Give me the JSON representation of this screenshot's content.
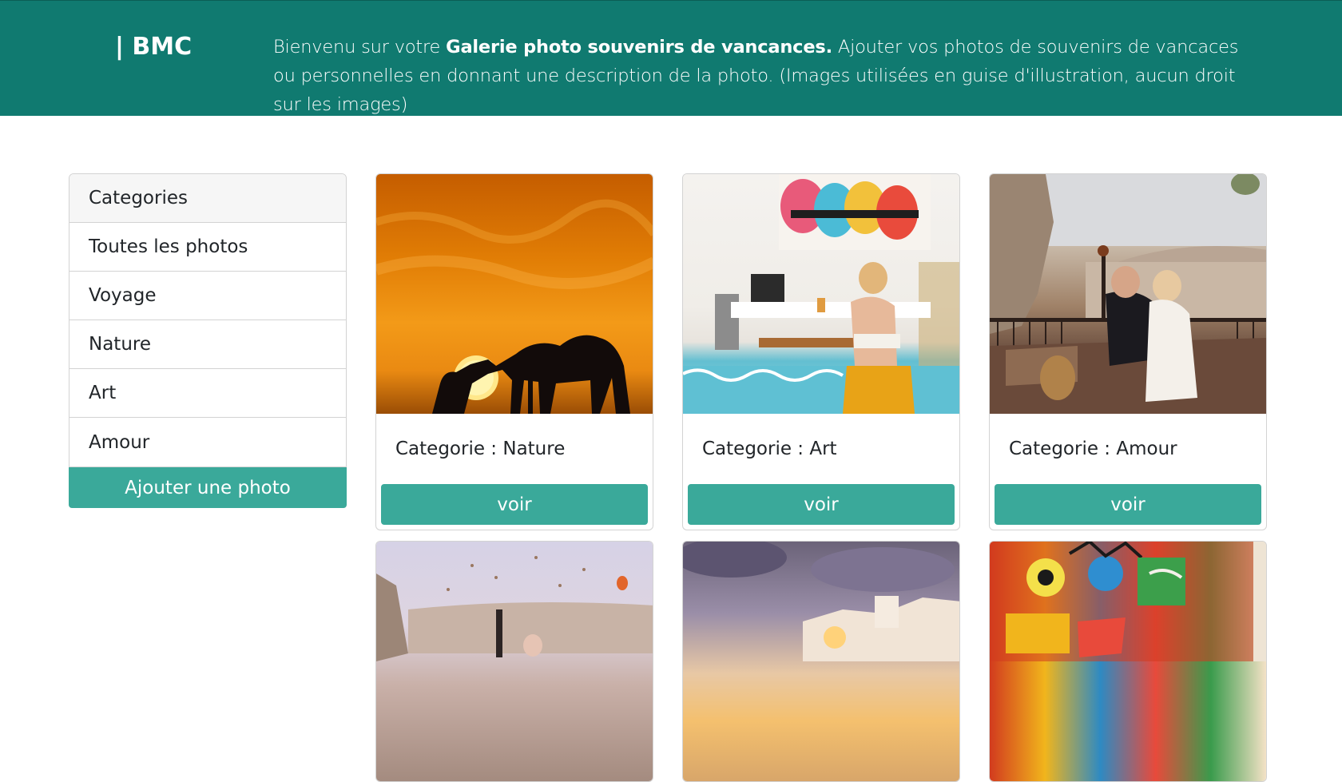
{
  "header": {
    "brand": "| BMC",
    "welcome_prefix": "Bienvenu sur votre ",
    "welcome_bold": "Galerie photo souvenirs de vancances.",
    "welcome_suffix": " Ajouter vos photos de souvenirs de vancaces ou personnelles en donnant une description de la photo. (Images utilisées en guise d'illustration, aucun droit sur les images)"
  },
  "sidebar": {
    "title": "Categories",
    "items": [
      {
        "label": "Toutes les photos"
      },
      {
        "label": "Voyage"
      },
      {
        "label": "Nature"
      },
      {
        "label": "Art"
      },
      {
        "label": "Amour"
      }
    ],
    "add_button": "Ajouter une photo"
  },
  "cards": [
    {
      "category": "Categorie : Nature",
      "button": "voir",
      "image": "camel-sunset-photo"
    },
    {
      "category": "Categorie : Art",
      "button": "voir",
      "image": "cafe-mural-photo"
    },
    {
      "category": "Categorie : Amour",
      "button": "voir",
      "image": "couple-terrace-photo"
    },
    {
      "image": "balloons-cappadocia-photo"
    },
    {
      "image": "santorini-sunset-photo"
    },
    {
      "image": "graffiti-art-photo"
    }
  ],
  "colors": {
    "header_bg": "#107a70",
    "accent": "#3aa99a"
  }
}
